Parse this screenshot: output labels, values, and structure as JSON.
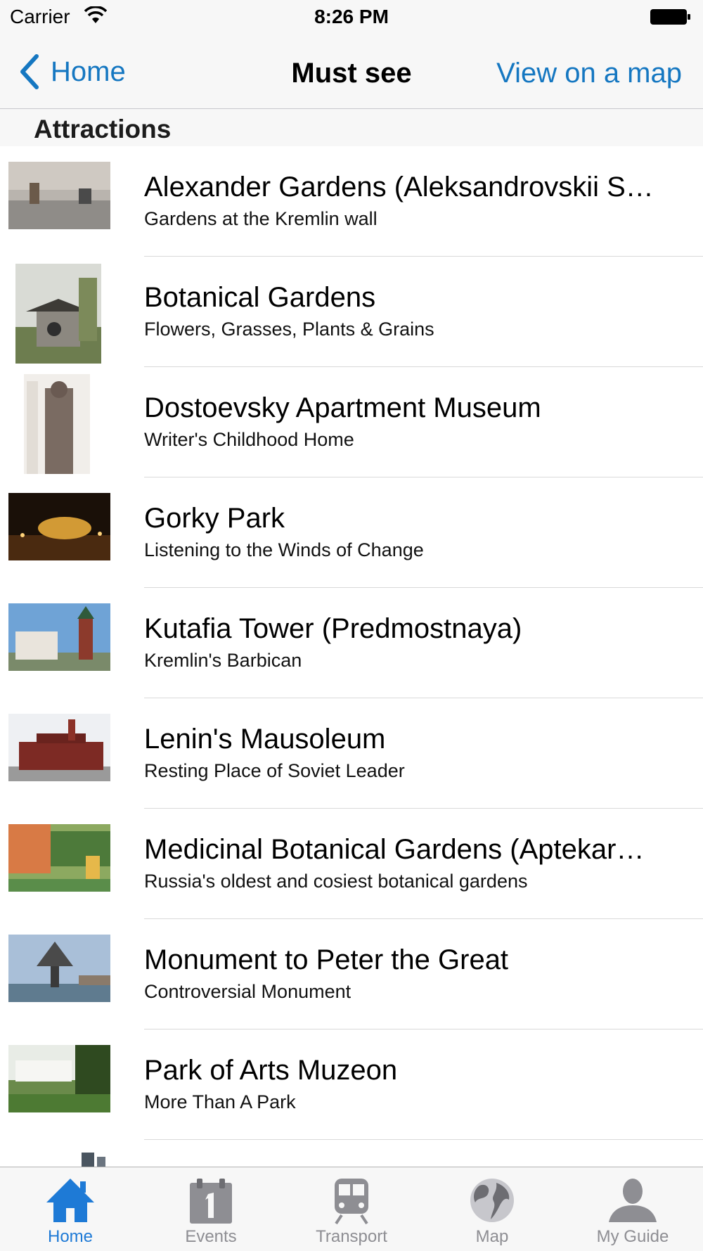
{
  "status_bar": {
    "carrier": "Carrier",
    "time": "8:26 PM"
  },
  "nav": {
    "back_label": "Home",
    "title": "Must see",
    "right_label": "View on a map"
  },
  "section": {
    "title": "Attractions"
  },
  "items": [
    {
      "title": "Alexander Gardens (Aleksandrovskii S…",
      "subtitle": "Gardens at the Kremlin wall"
    },
    {
      "title": "Botanical Gardens",
      "subtitle": "Flowers, Grasses, Plants & Grains"
    },
    {
      "title": "Dostoevsky Apartment Museum",
      "subtitle": "Writer's Childhood Home"
    },
    {
      "title": "Gorky Park",
      "subtitle": "Listening to the Winds of Change"
    },
    {
      "title": "Kutafia Tower  (Predmostnaya)",
      "subtitle": "Kremlin's Barbican"
    },
    {
      "title": "Lenin's Mausoleum",
      "subtitle": "Resting Place of Soviet Leader"
    },
    {
      "title": "Medicinal Botanical Gardens (Aptekar…",
      "subtitle": "Russia's oldest and cosiest botanical gardens"
    },
    {
      "title": "Monument to Peter the Great",
      "subtitle": "Controversial Monument"
    },
    {
      "title": "Park of Arts Muzeon",
      "subtitle": "More Than A Park"
    }
  ],
  "tabs": [
    {
      "label": "Home",
      "icon": "home-icon",
      "active": true
    },
    {
      "label": "Events",
      "icon": "calendar-icon",
      "active": false
    },
    {
      "label": "Transport",
      "icon": "train-icon",
      "active": false
    },
    {
      "label": "Map",
      "icon": "globe-icon",
      "active": false
    },
    {
      "label": "My Guide",
      "icon": "person-icon",
      "active": false
    }
  ],
  "colors": {
    "accent": "#1577c1",
    "tab_active": "#1e7ad6",
    "tab_inactive": "#8e8e93"
  }
}
